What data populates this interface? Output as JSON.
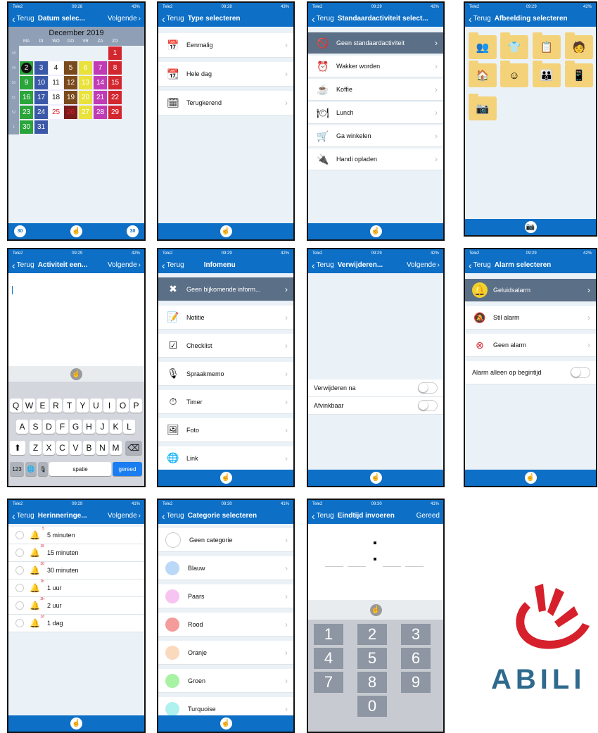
{
  "status": {
    "carrier": "Tele2",
    "battery1": "43%",
    "battery2": "42%",
    "battery3": "41%"
  },
  "screens": {
    "s1": {
      "time": "09:28",
      "back": "Terug",
      "title": "Datum selec...",
      "next": "Volgende",
      "month": "December 2019",
      "days": [
        "MA",
        "DI",
        "WO",
        "DO",
        "VR",
        "ZA",
        "ZO"
      ],
      "weeks": [
        "48",
        "49",
        "50",
        "51",
        "52",
        "1"
      ],
      "btn_left": "30",
      "btn_right": "30"
    },
    "s2": {
      "time": "09:28",
      "back": "Terug",
      "title": "Type selecteren",
      "items": [
        "Eenmalig",
        "Hele dag",
        "Terugkerend"
      ]
    },
    "s3": {
      "time": "09:29",
      "back": "Terug",
      "title": "Standaardactiviteit select...",
      "items": [
        "Geen standaardactiviteit",
        "Wakker worden",
        "Koffie",
        "Lunch",
        "Ga winkelen",
        "Handi opladen"
      ]
    },
    "s4": {
      "time": "09:29",
      "back": "Terug",
      "title": "Afbeelding selecteren"
    },
    "s5": {
      "time": "09:29",
      "back": "Terug",
      "title": "Activiteit een...",
      "next": "Volgende",
      "row1": [
        "Q",
        "W",
        "E",
        "R",
        "T",
        "Y",
        "U",
        "I",
        "O",
        "P"
      ],
      "row2": [
        "A",
        "S",
        "D",
        "F",
        "G",
        "H",
        "J",
        "K",
        "L"
      ],
      "row3": [
        "Z",
        "X",
        "C",
        "V",
        "B",
        "N",
        "M"
      ],
      "k123": "123",
      "space": "spatie",
      "done": "gereed"
    },
    "s6": {
      "time": "09:29",
      "back": "Terug",
      "title": "Infomenu",
      "items": [
        "Geen bijkomende inform...",
        "Notitie",
        "Checklist",
        "Spraakmemo",
        "Timer",
        "Foto",
        "Link"
      ]
    },
    "s7": {
      "time": "09:29",
      "back": "Terug",
      "title": "Verwijderen...",
      "next": "Volgende",
      "opt1": "Verwijderen na",
      "opt2": "Afvinkbaar"
    },
    "s8": {
      "time": "09:29",
      "back": "Terug",
      "title": "Alarm selecteren",
      "items": [
        "Geluidsalarm",
        "Stil alarm",
        "Geen alarm"
      ],
      "opt": "Alarm alleen op begintijd"
    },
    "s9": {
      "time": "09:29",
      "back": "Terug",
      "title": "Herinneringe...",
      "next": "Volgende",
      "items": [
        {
          "badge": "5",
          "label": "5 minuten"
        },
        {
          "badge": "15",
          "label": "15 minuten"
        },
        {
          "badge": "30",
          "label": "30 minuten"
        },
        {
          "badge": "1h",
          "label": "1 uur"
        },
        {
          "badge": "2h",
          "label": "2 uur"
        },
        {
          "badge": "1d",
          "label": "1 dag"
        }
      ]
    },
    "s10": {
      "time": "09:30",
      "back": "Terug",
      "title": "Categorie selecteren",
      "items": [
        {
          "label": "Geen categorie",
          "color": "#ffffff"
        },
        {
          "label": "Blauw",
          "color": "#bcd8f8"
        },
        {
          "label": "Paars",
          "color": "#f7c4f2"
        },
        {
          "label": "Rood",
          "color": "#f49b9b"
        },
        {
          "label": "Oranje",
          "color": "#fbd9bd"
        },
        {
          "label": "Groen",
          "color": "#a8f2a3"
        },
        {
          "label": "Turquoise",
          "color": "#aef1ee"
        }
      ]
    },
    "s11": {
      "time": "09:30",
      "back": "Terug",
      "title": "Eindtijd invoeren",
      "next": "Gereed",
      "keys": [
        "1",
        "2",
        "3",
        "4",
        "5",
        "6",
        "7",
        "8",
        "9",
        "0"
      ]
    }
  },
  "logo": {
    "text": "ABILI",
    "color": "#d6202b"
  }
}
